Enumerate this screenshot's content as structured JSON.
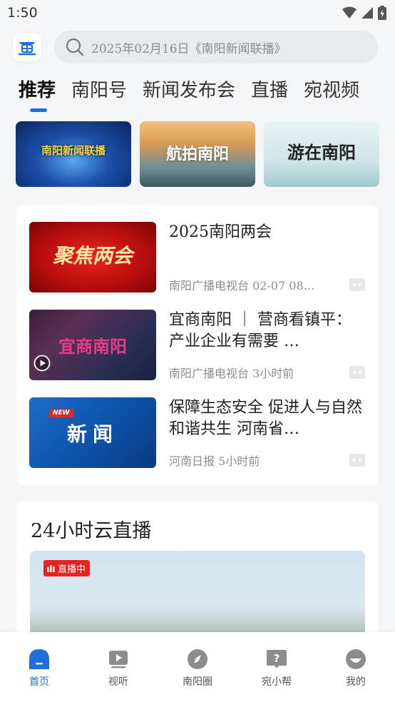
{
  "status_bar": {
    "time": "1:50"
  },
  "search": {
    "placeholder": "2025年02月16日《南阳新闻联播》"
  },
  "tabs": [
    {
      "label": "推荐",
      "active": true
    },
    {
      "label": "南阳号",
      "active": false
    },
    {
      "label": "新闻发布会",
      "active": false
    },
    {
      "label": "直播",
      "active": false
    },
    {
      "label": "宛视频",
      "active": false
    }
  ],
  "banners": [
    {
      "label": "南阳新闻联播"
    },
    {
      "label": "航拍南阳"
    },
    {
      "label": "游在南阳"
    }
  ],
  "news": [
    {
      "thumb_title": "聚焦两会",
      "title": "2025南阳两会",
      "meta": "南阳广播电视台 02-07 08…"
    },
    {
      "thumb_title": "宜商南阳",
      "title": "宜商南阳 ｜ 营商看镇平：产业企业有需要 …",
      "meta": "南阳广播电视台 3小时前"
    },
    {
      "thumb_badge": "NEW",
      "thumb_title": "新闻",
      "title": "保障生态安全 促进人与自然和谐共生 河南省…",
      "meta": "河南日报 5小时前"
    }
  ],
  "live": {
    "heading": "24小时云直播",
    "badge": "直播中"
  },
  "bottom_nav": [
    {
      "label": "首页",
      "icon": "home-icon",
      "active": true
    },
    {
      "label": "视听",
      "icon": "video-icon",
      "active": false
    },
    {
      "label": "南阳圈",
      "icon": "compass-icon",
      "active": false
    },
    {
      "label": "宛小帮",
      "icon": "help-icon",
      "active": false
    },
    {
      "label": "我的",
      "icon": "profile-icon",
      "active": false
    }
  ],
  "colors": {
    "accent": "#1e6fd9",
    "live_red": "#e8221f",
    "background": "#f4f5f7"
  }
}
